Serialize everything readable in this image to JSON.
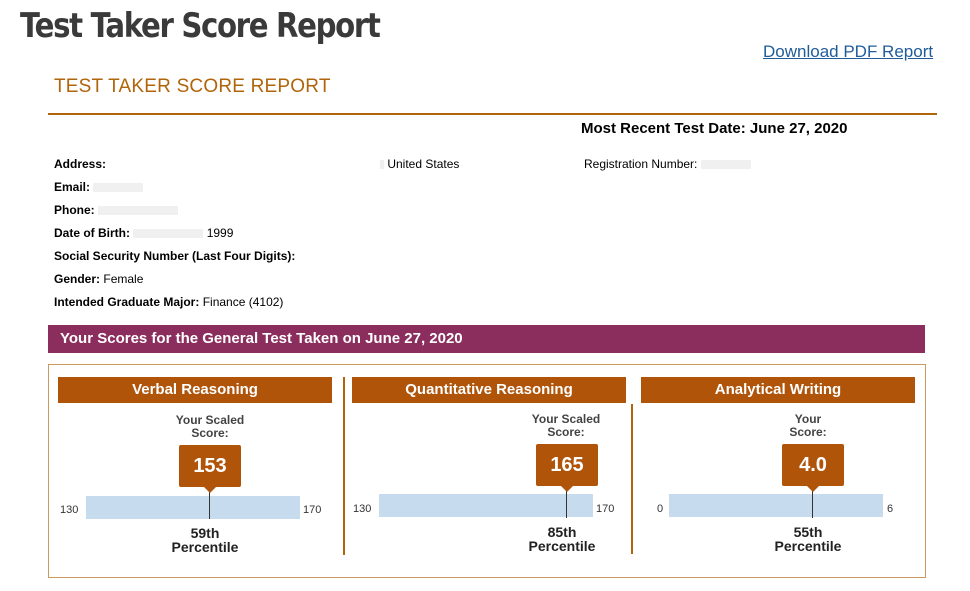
{
  "header": {
    "main_title": "Test Taker Score Report",
    "download_link": "Download PDF Report",
    "report_heading": "TEST TAKER SCORE REPORT",
    "most_recent_test_date": "Most Recent Test Date: June 27, 2020"
  },
  "test_taker": {
    "address_label": "Address:",
    "address_country": "United States",
    "registration_label": "Registration Number:",
    "email_label": "Email:",
    "phone_label": "Phone:",
    "dob_label": "Date of Birth:",
    "dob_year": "1999",
    "ssn_label": "Social Security Number (Last Four Digits):",
    "gender_label": "Gender:",
    "gender_value": "Female",
    "major_label": "Intended Graduate Major:",
    "major_value": "Finance (4102)"
  },
  "scores_section": {
    "title": "Your Scores for the General Test Taken on June 27, 2020",
    "colors": {
      "bar": "#8b2e5d",
      "accent": "#b0540a",
      "scale": "#c7dbee"
    },
    "panels": [
      {
        "name": "Verbal Reasoning",
        "label_line1": "Your Scaled",
        "label_line2": "Score:",
        "score": "153",
        "scale_min": "130",
        "scale_max": "170",
        "percentile_line1": "59th",
        "percentile_line2": "Percentile"
      },
      {
        "name": "Quantitative Reasoning",
        "label_line1": "Your Scaled",
        "label_line2": "Score:",
        "score": "165",
        "scale_min": "130",
        "scale_max": "170",
        "percentile_line1": "85th",
        "percentile_line2": "Percentile"
      },
      {
        "name": "Analytical Writing",
        "label_line1": "Your",
        "label_line2": "Score:",
        "score": "4.0",
        "scale_min": "0",
        "scale_max": "6",
        "percentile_line1": "55th",
        "percentile_line2": "Percentile"
      }
    ]
  }
}
